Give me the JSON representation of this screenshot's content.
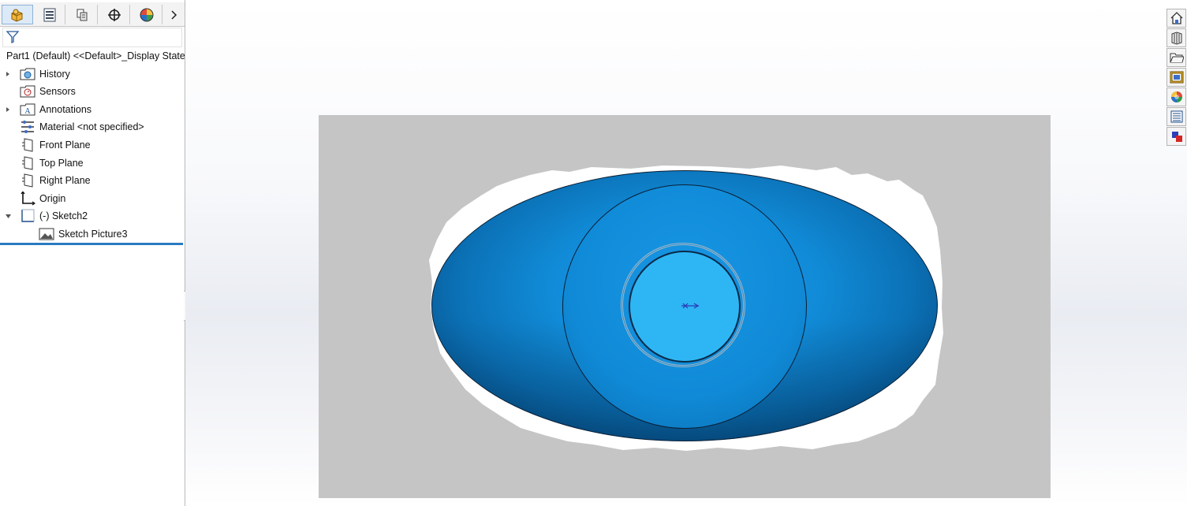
{
  "feature_manager": {
    "tabs": [
      {
        "icon": "part-tree-icon",
        "label": "FeatureManager Design Tree",
        "active": true
      },
      {
        "icon": "property-manager-icon",
        "label": "PropertyManager"
      },
      {
        "icon": "configuration-manager-icon",
        "label": "ConfigurationManager"
      },
      {
        "icon": "dimxpert-icon",
        "label": "DimXpertManager"
      },
      {
        "icon": "display-manager-icon",
        "label": "DisplayManager"
      }
    ],
    "more_icon": "chevron-right-icon",
    "filter": {
      "icon": "filter-icon",
      "value": "",
      "placeholder": ""
    },
    "root": {
      "label": "Part1 (Default) <<Default>_Display State",
      "icon": "part-icon"
    },
    "items": [
      {
        "label": "History",
        "icon": "history-icon",
        "expandable": true,
        "expanded": false
      },
      {
        "label": "Sensors",
        "icon": "sensors-icon",
        "expandable": false
      },
      {
        "label": "Annotations",
        "icon": "annotations-icon",
        "expandable": true,
        "expanded": false
      },
      {
        "label": "Material <not specified>",
        "icon": "material-icon",
        "expandable": false
      },
      {
        "label": "Front Plane",
        "icon": "plane-icon",
        "expandable": false
      },
      {
        "label": "Top Plane",
        "icon": "plane-icon",
        "expandable": false
      },
      {
        "label": "Right Plane",
        "icon": "plane-icon",
        "expandable": false
      },
      {
        "label": "Origin",
        "icon": "origin-icon",
        "expandable": false
      },
      {
        "label": "(-) Sketch2",
        "icon": "sketch-icon",
        "expandable": true,
        "expanded": true
      },
      {
        "label": "Sketch Picture3",
        "icon": "sketch-picture-icon",
        "expandable": false,
        "child": true
      }
    ]
  },
  "graphics_area": {
    "sketch_picture": "Sketch Picture3",
    "colors": {
      "frame_gray": "#c5c5c6",
      "body_blue": "#118bd7",
      "pupil_blue": "#2eb6f4",
      "edge_dark": "#0b1f35"
    }
  },
  "task_pane": {
    "buttons": [
      {
        "icon": "solidworks-resources-icon",
        "label": "SOLIDWORKS Resources"
      },
      {
        "icon": "design-library-icon",
        "label": "Design Library"
      },
      {
        "icon": "file-explorer-icon",
        "label": "File Explorer"
      },
      {
        "icon": "view-palette-icon",
        "label": "View Palette"
      },
      {
        "icon": "appearances-icon",
        "label": "Appearances, Scenes, and Decals"
      },
      {
        "icon": "custom-properties-icon",
        "label": "Custom Properties"
      },
      {
        "icon": "solidworks-forum-icon",
        "label": "SOLIDWORKS Forum"
      }
    ]
  }
}
